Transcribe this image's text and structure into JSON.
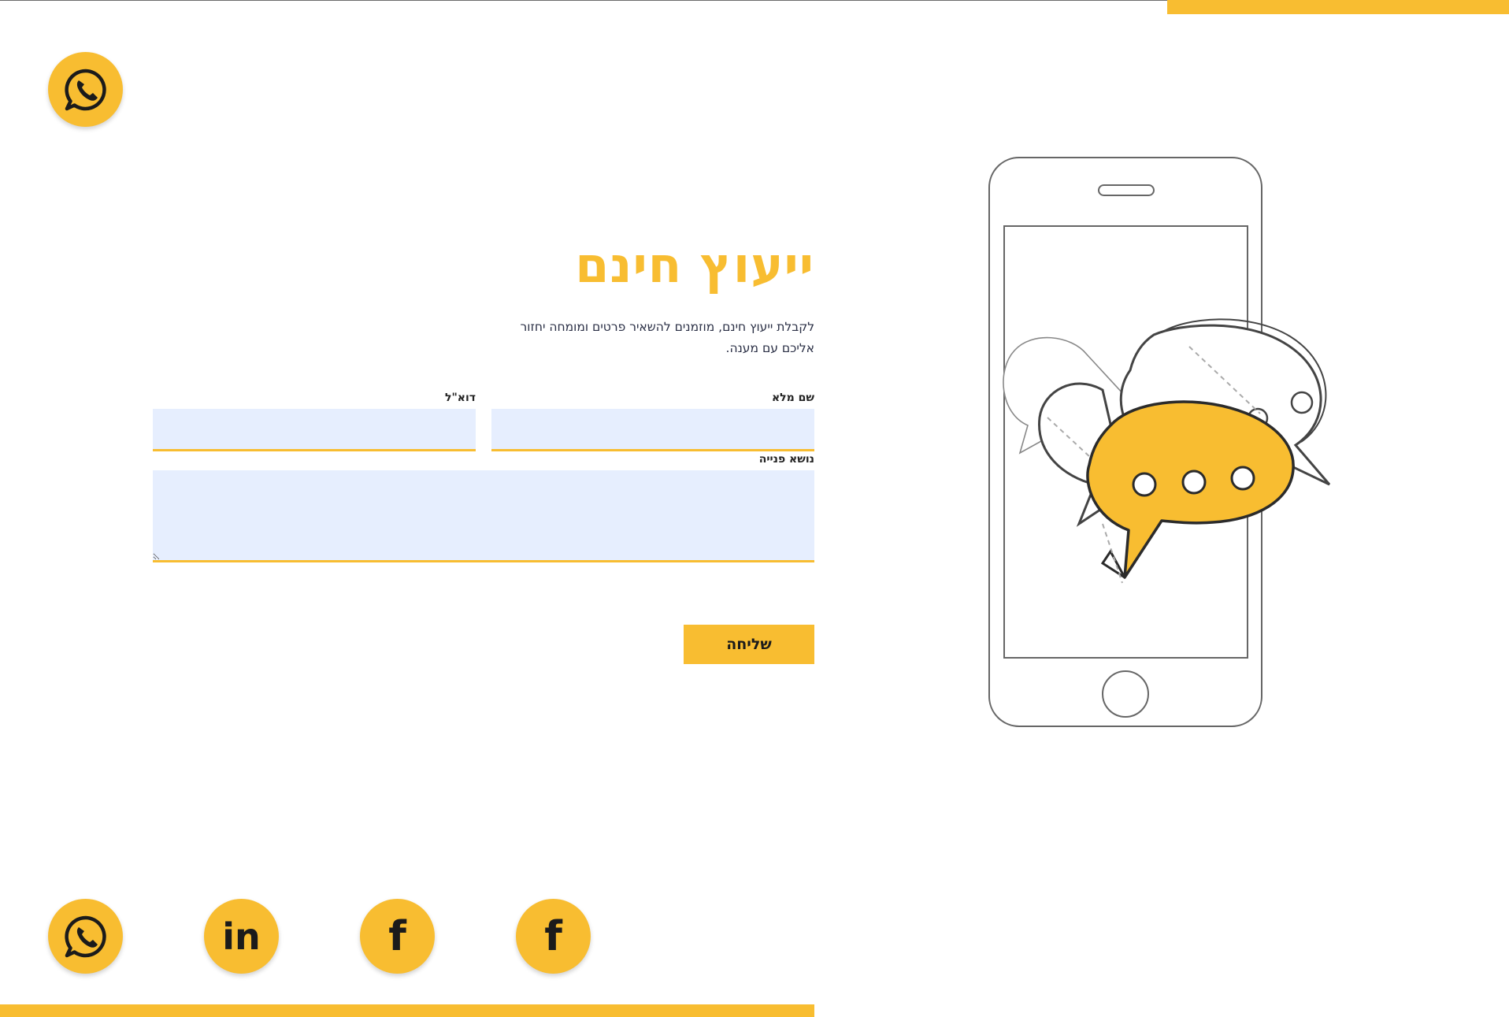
{
  "colors": {
    "accent": "#f8bd31",
    "field_background": "#e6eefe",
    "text_dark": "#2a2f45",
    "outline": "#555555"
  },
  "floating_whatsapp": {
    "icon": "whatsapp-icon"
  },
  "hero": {
    "title": "ייעוץ חינם",
    "description": "לקבלת ייעוץ חינם, מוזמנים להשאיר פרטים ומומחה יחזור אליכם עם מענה."
  },
  "form": {
    "full_name_label": "שם מלא",
    "full_name_value": "",
    "email_label": "דוא\"ל",
    "email_value": "",
    "subject_label": "נושא פנייה",
    "subject_value": "",
    "submit_label": "שליחה"
  },
  "social": [
    {
      "icon": "whatsapp-icon",
      "glyph": ""
    },
    {
      "icon": "linkedin-icon",
      "glyph": "in"
    },
    {
      "icon": "facebook-icon",
      "glyph": "f"
    },
    {
      "icon": "facebook-icon",
      "glyph": "f"
    }
  ],
  "illustration": {
    "icon": "phone-chat-bubbles-illustration"
  }
}
